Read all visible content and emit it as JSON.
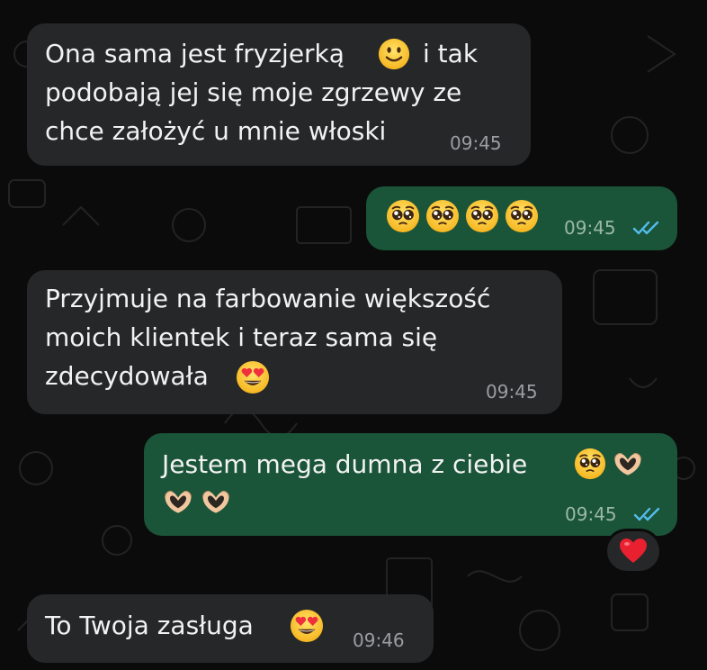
{
  "chat": {
    "messages": [
      {
        "direction": "incoming",
        "lines": [
          "Ona sama jest fryzjerką",
          "podobają jej się moje zgrzewy ze",
          "chce założyć u mnie włoski"
        ],
        "inline_after_emoji": "i tak",
        "emojis": [
          "slightly-smiling-face"
        ],
        "time": "09:45"
      },
      {
        "direction": "outgoing",
        "emojis": [
          "pleading-face",
          "pleading-face",
          "pleading-face",
          "pleading-face"
        ],
        "time": "09:45",
        "status": "read"
      },
      {
        "direction": "incoming",
        "lines": [
          "Przyjmuje na farbowanie większość",
          "moich klientek i teraz sama się",
          "zdecydowała"
        ],
        "emojis": [
          "smiling-face-with-heart-eyes"
        ],
        "time": "09:45"
      },
      {
        "direction": "outgoing",
        "lines": [
          "Jestem mega dumna z ciebie"
        ],
        "emojis": [
          "pleading-face",
          "heart-hands",
          "heart-hands",
          "heart-hands"
        ],
        "time": "09:45",
        "status": "read",
        "reaction": "red-heart"
      },
      {
        "direction": "incoming",
        "lines": [
          "To Twoja zasługa"
        ],
        "emojis": [
          "smiling-face-with-heart-eyes"
        ],
        "time": "09:46"
      }
    ]
  },
  "colors": {
    "background": "#0b0b0b",
    "incoming_bubble": "#262729",
    "outgoing_bubble": "#1a5439",
    "read_ticks": "#53bdeb",
    "text": "#f2f2f2"
  },
  "icons": {
    "read_status": "double-check-icon",
    "reaction": "red-heart-icon"
  }
}
